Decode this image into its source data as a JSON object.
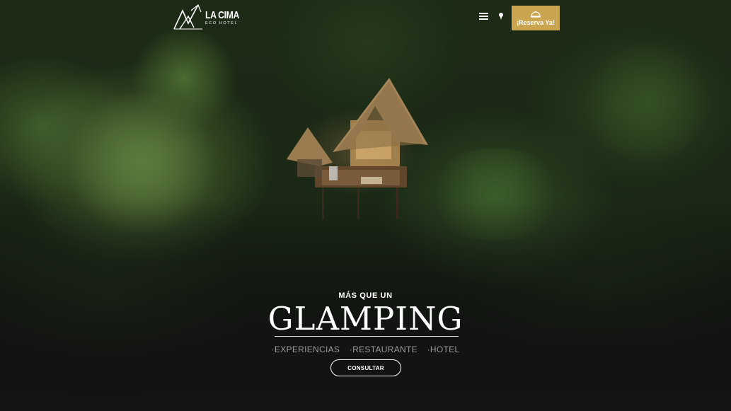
{
  "brand": {
    "name": "LA CIMA",
    "subtitle": "ECO HOTEL"
  },
  "header": {
    "menu_icon": "hamburger-menu-icon",
    "location_icon": "map-pin-icon",
    "reserve": {
      "icon": "service-bell-icon",
      "label": "¡Reserva Ya!"
    }
  },
  "hero": {
    "eyebrow": "MÁS QUE UN",
    "headline": "GLAMPING",
    "services": [
      "·EXPERIENCIAS",
      "·RESTAURANTE",
      "·HOTEL"
    ],
    "cta_label": "CONSULTAR"
  },
  "colors": {
    "accent_gold": "#c9a552",
    "overlay_dark": "#141414",
    "foliage_green": "#3d5a2a"
  }
}
